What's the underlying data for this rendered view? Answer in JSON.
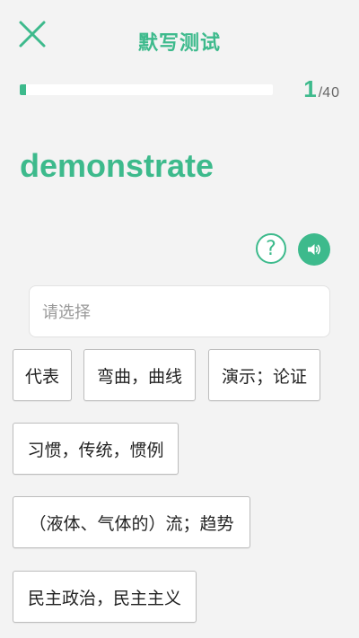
{
  "header": {
    "title": "默写测试",
    "close_icon": "close-icon"
  },
  "progress": {
    "current": "1",
    "separator": "/",
    "total": "40",
    "fraction": 0.025
  },
  "question": {
    "word": "demonstrate"
  },
  "actions": {
    "help_symbol": "?",
    "audio_icon": "speaker-icon"
  },
  "answer": {
    "placeholder": "请选择"
  },
  "options": [
    "代表",
    "弯曲，曲线",
    "演示；论证",
    "习惯，传统，惯例",
    "（液体、气体的）流；趋势",
    "民主政治，民主主义"
  ],
  "colors": {
    "accent": "#3dba8c",
    "background": "#f3f3f3"
  }
}
